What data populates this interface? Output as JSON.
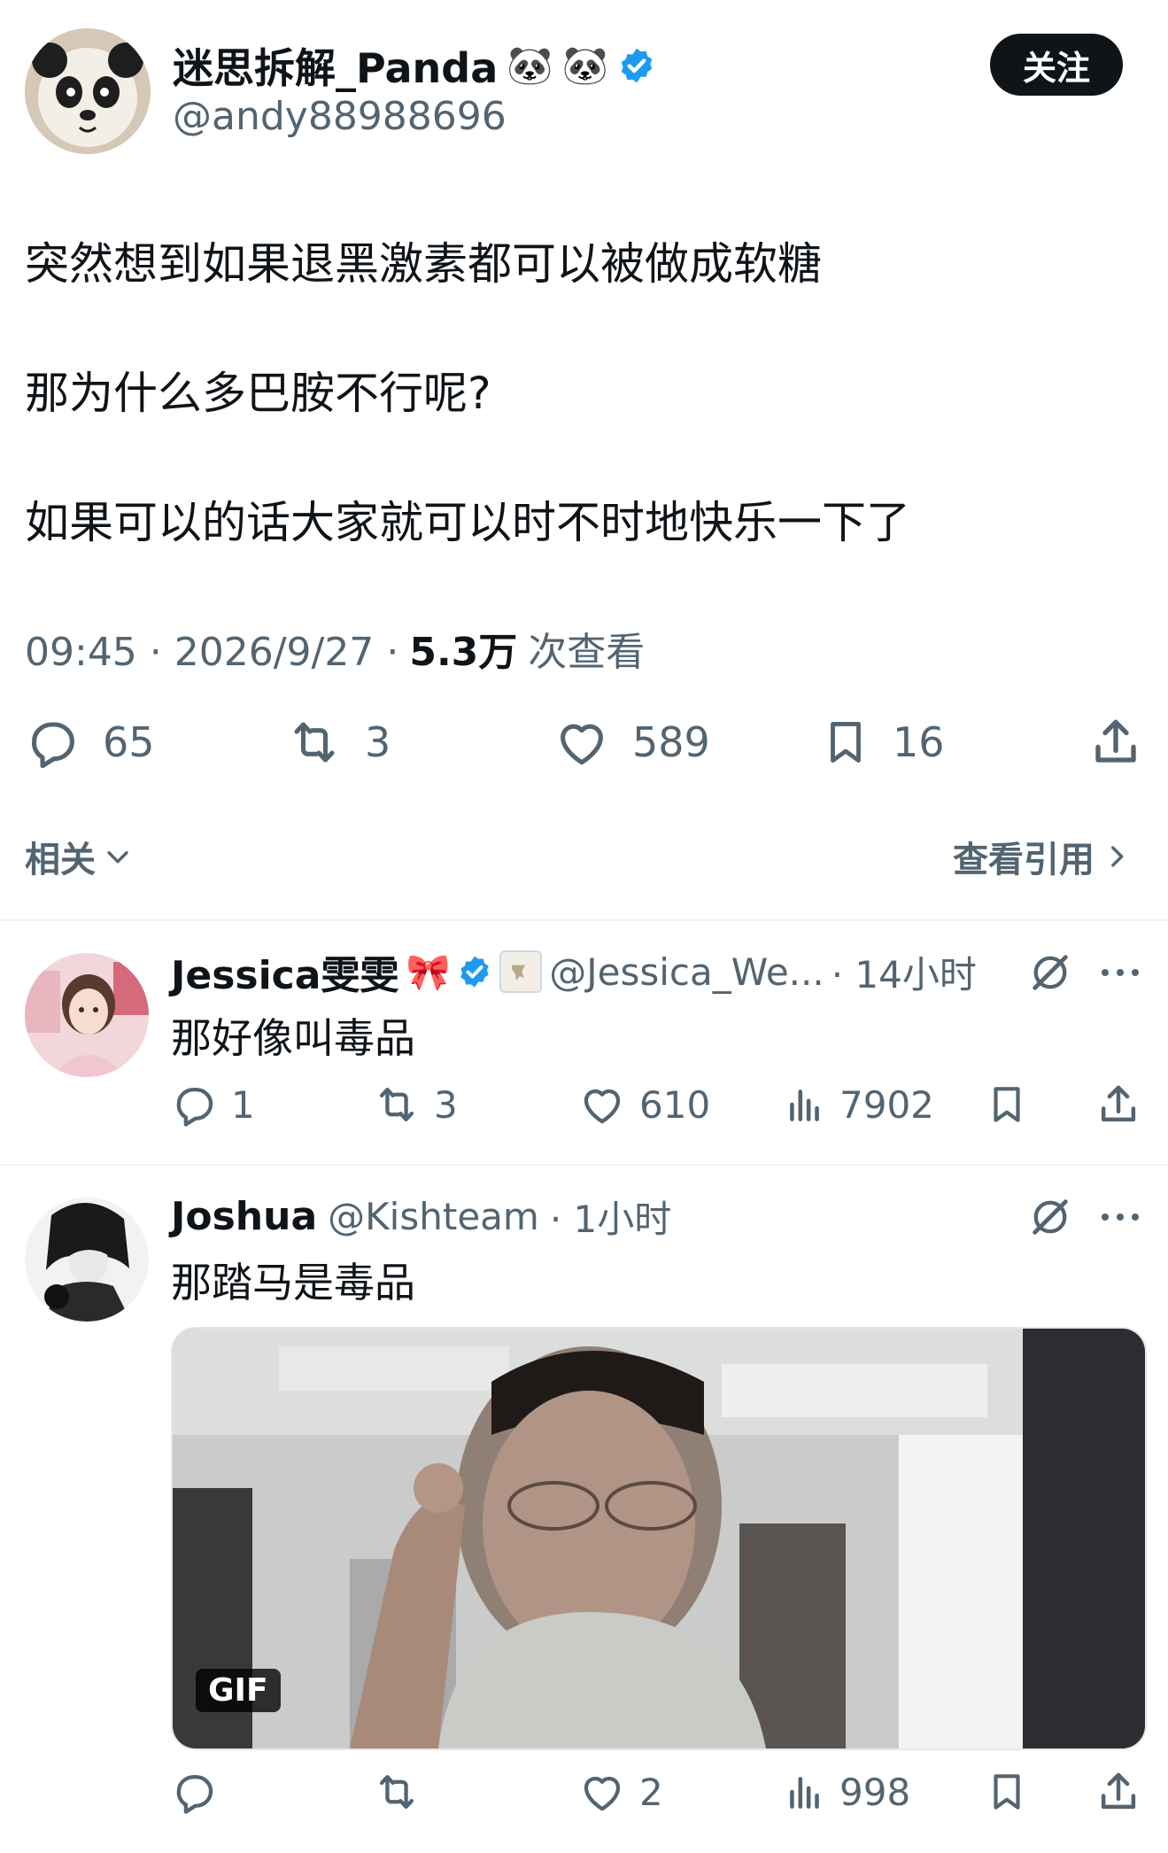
{
  "main_tweet": {
    "author_name": "迷思拆解_Panda",
    "emoji_1": "🐼",
    "emoji_2": "🐼",
    "handle": "@andy88988696",
    "follow_label": "关注",
    "text_line1": "突然想到如果退黑激素都可以被做成软糖",
    "text_line2": "那为什么多巴胺不行呢?",
    "text_line3": "如果可以的话大家就可以时不时地快乐一下了",
    "time": "09:45 · 2026/9/27 ·",
    "views_count": "5.3万",
    "views_label": "次查看",
    "replies": "65",
    "retweets": "3",
    "likes": "589",
    "bookmarks": "16"
  },
  "related": {
    "label": "相关",
    "quotes_link": "查看引用"
  },
  "replies": [
    {
      "author_name": "Jessica雯雯",
      "emoji": "🎀",
      "handle": "@Jessica_We...",
      "time": "· 14小时",
      "text": "那好像叫毒品",
      "replies": "1",
      "retweets": "3",
      "likes": "610",
      "views": "7902"
    },
    {
      "author_name": "Joshua",
      "handle": "@Kishteam",
      "time": "· 1小时",
      "text": "那踏马是毒品",
      "media_badge": "GIF",
      "likes": "2",
      "views": "998"
    }
  ],
  "colors": {
    "verified": "#1d9bf0",
    "text": "#0f1419",
    "muted": "#536471",
    "divider": "#eff3f4"
  }
}
